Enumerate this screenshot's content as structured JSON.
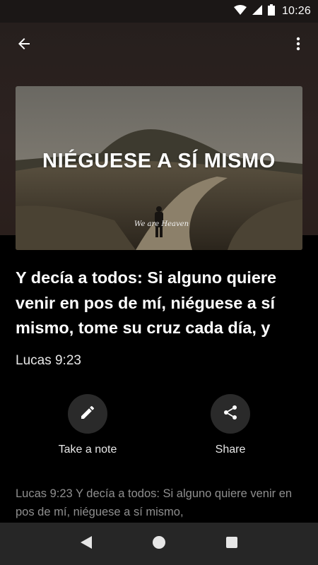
{
  "status_bar": {
    "time": "10:26"
  },
  "hero": {
    "title": "NIÉGUESE A SÍ MISMO",
    "watermark": "We are Heaven"
  },
  "verse": {
    "text": "Y decía a todos: Si alguno quiere venir en pos de mí, niéguese a sí mismo, tome su  cruz cada día, y",
    "reference": "Lucas 9:23"
  },
  "actions": {
    "note_label": "Take a note",
    "share_label": "Share"
  },
  "passage": {
    "text": "Lucas 9:23 Y decía a todos: Si alguno quiere venir en pos de mí, niéguese a sí mismo,"
  },
  "colors": {
    "toolbar_bg": "#2d2220",
    "action_circle": "#2a2a2a",
    "nav_bar": "#262626"
  }
}
